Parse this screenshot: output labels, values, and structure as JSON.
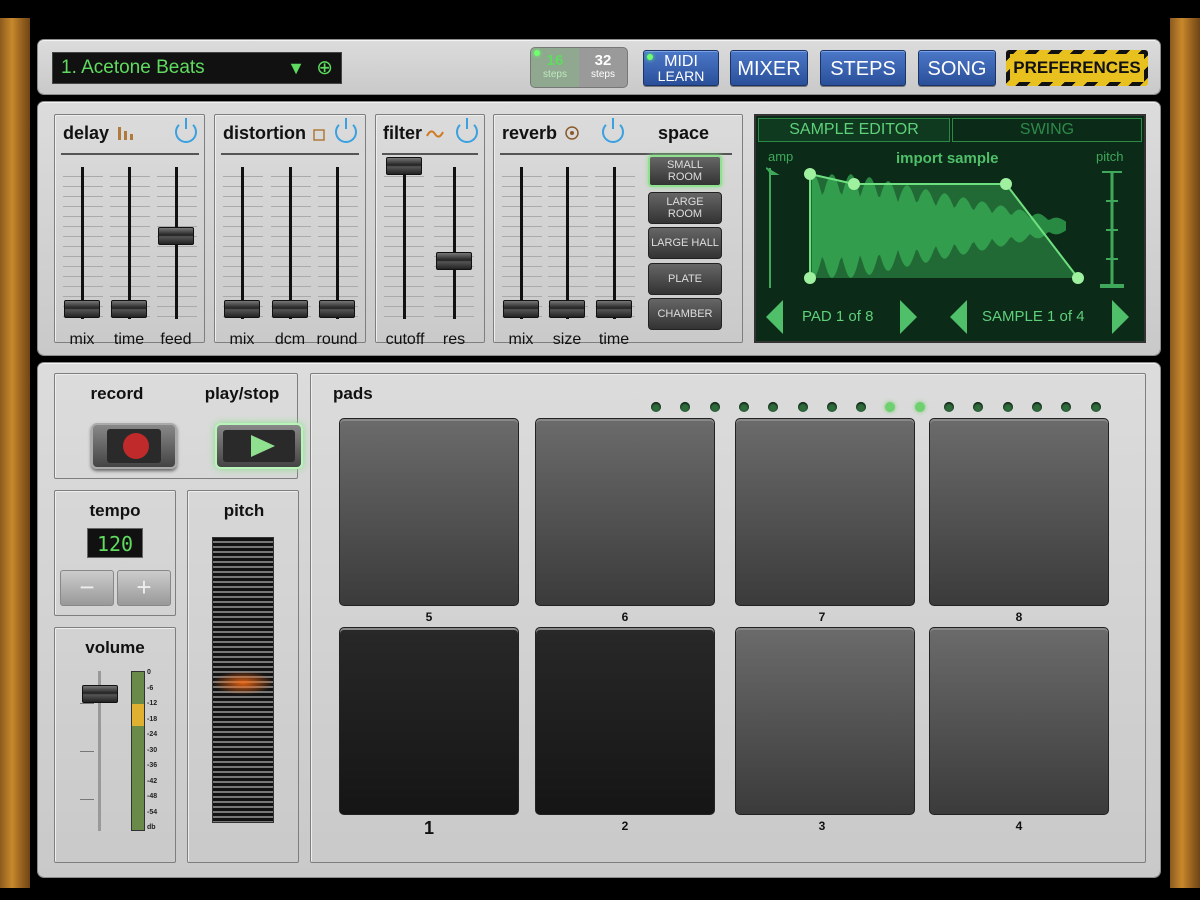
{
  "topbar": {
    "preset_name": "1. Acetone Beats",
    "steps_16": "16",
    "steps_32": "32",
    "steps_unit": "steps",
    "midi_line1": "MIDI",
    "midi_line2": "LEARN",
    "mixer": "MIXER",
    "steps": "STEPS",
    "song": "SONG",
    "preferences": "PREFERENCES",
    "dropdown_glyph": "▼",
    "add_glyph": "⊕"
  },
  "fx": {
    "delay": {
      "title": "delay",
      "labels": [
        "mix",
        "time",
        "feed"
      ]
    },
    "distortion": {
      "title": "distortion",
      "labels": [
        "mix",
        "dcm",
        "round"
      ]
    },
    "filter": {
      "title": "filter",
      "labels": [
        "cutoff",
        "res"
      ]
    },
    "reverb": {
      "title": "reverb",
      "labels": [
        "mix",
        "size",
        "time"
      ]
    },
    "space": {
      "title": "space",
      "rooms": [
        "SMALL ROOM",
        "LARGE ROOM",
        "LARGE HALL",
        "PLATE",
        "CHAMBER"
      ],
      "selected": "SMALL ROOM"
    }
  },
  "sample_editor": {
    "tab_sample": "SAMPLE EDITOR",
    "tab_swing": "SWING",
    "amp": "amp",
    "import": "import sample",
    "pitch": "pitch",
    "pad_nav": "PAD 1 of 8",
    "sample_nav": "SAMPLE 1 of 4"
  },
  "transport": {
    "record": "record",
    "play": "play/stop"
  },
  "tempo": {
    "title": "tempo",
    "value": "120",
    "minus": "−",
    "plus": "+"
  },
  "pitch": {
    "title": "pitch"
  },
  "volume": {
    "title": "volume",
    "db_labels": [
      "0",
      "-6",
      "-12",
      "-18",
      "-24",
      "-30",
      "-36",
      "-42",
      "-48",
      "-54",
      "db"
    ]
  },
  "pads": {
    "title": "pads",
    "top_row": [
      "5",
      "6",
      "7",
      "8"
    ],
    "bottom_row": [
      "1",
      "2",
      "3",
      "4"
    ],
    "step_leds": 16,
    "lit_leds": [
      8,
      9
    ]
  },
  "colors": {
    "accent_green": "#5fdc5f",
    "nav_blue": "#2a4f99",
    "power_blue": "#3aa0e0"
  }
}
